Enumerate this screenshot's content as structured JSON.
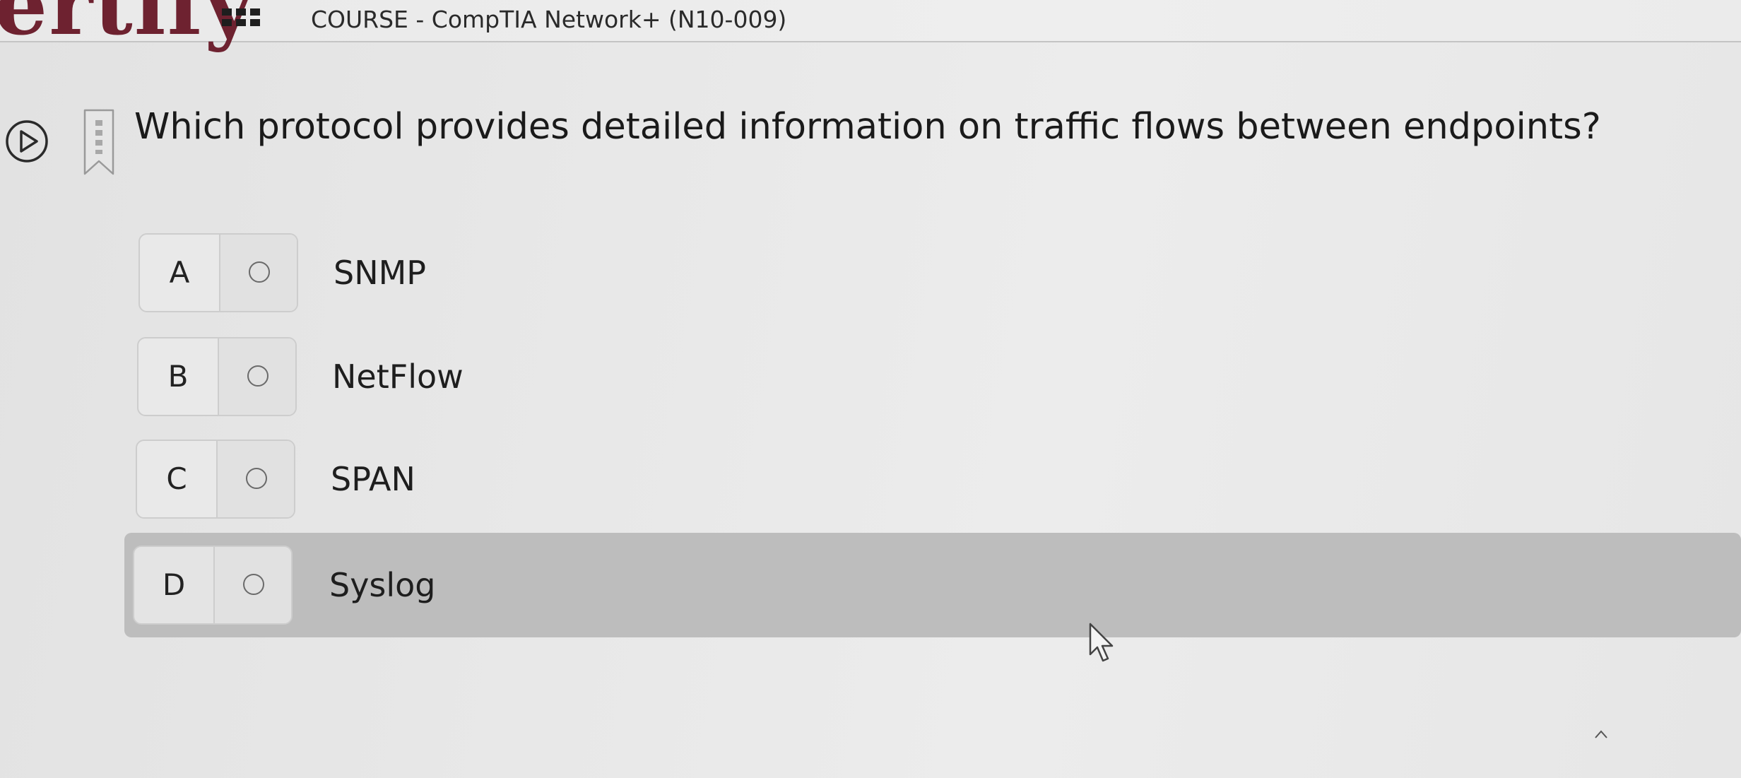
{
  "header": {
    "logo_text": "ertify",
    "course_title": "COURSE - CompTIA Network+ (N10-009)"
  },
  "question": {
    "text": "Which protocol provides detailed information on traffic flows between endpoints?"
  },
  "options": [
    {
      "letter": "A",
      "text": "SNMP"
    },
    {
      "letter": "B",
      "text": "NetFlow"
    },
    {
      "letter": "C",
      "text": "SPAN"
    },
    {
      "letter": "D",
      "text": "Syslog"
    }
  ],
  "colors": {
    "logo": "#6e2230",
    "highlight_row": "#bdbdbd"
  },
  "icons": {
    "apps": "apps-grid-icon",
    "play": "play-circle-icon",
    "bookmark": "bookmark-icon",
    "radio": "radio-unselected-icon",
    "cursor": "mouse-pointer-icon"
  }
}
